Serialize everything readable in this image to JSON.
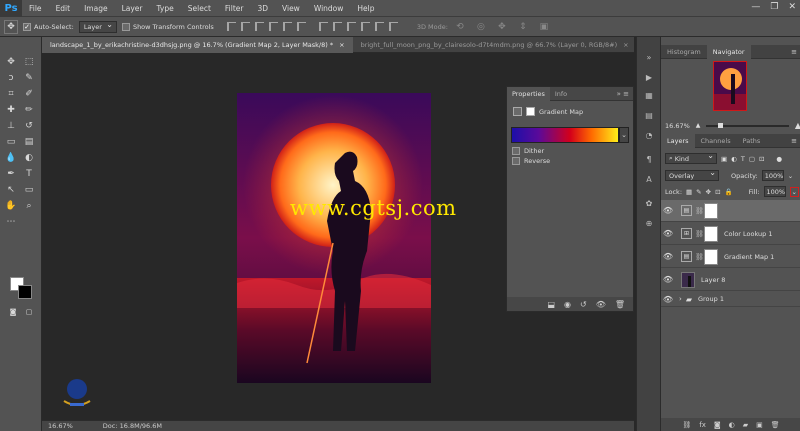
{
  "app": {
    "logo": "Ps"
  },
  "menu": [
    "File",
    "Edit",
    "Image",
    "Layer",
    "Type",
    "Select",
    "Filter",
    "3D",
    "View",
    "Window",
    "Help"
  ],
  "window_controls": [
    "—",
    "❐",
    "✕"
  ],
  "options_bar": {
    "auto_select_label": "Auto-Select:",
    "auto_select_value": "Layer",
    "show_transform_label": "Show Transform Controls",
    "mode_3d_label": "3D Mode:"
  },
  "tabs": [
    {
      "label": "landscape_1_by_erikachristine-d3dhsjg.png @ 16.7% (Gradient Map 2, Layer Mask/8) *",
      "close": "×"
    },
    {
      "label": "bright_full_moon_png_by_clairesolo-d7t4mdm.png @ 66.7% (Layer 0, RGB/8#)",
      "close": "×"
    }
  ],
  "watermark": "www.cgtsj.com",
  "status": {
    "zoom": "16.67%",
    "doc": "Doc: 16.8M/96.6M"
  },
  "properties": {
    "tabs": [
      "Properties",
      "Info"
    ],
    "title": "Gradient Map",
    "dither_label": "Dither",
    "reverse_label": "Reverse",
    "gradient_colors": [
      "#1c0fa8",
      "#5a0a9a",
      "#d4001a",
      "#ff6a00",
      "#ffef1a"
    ]
  },
  "navigator": {
    "tabs": [
      "Histogram",
      "Navigator"
    ],
    "zoom": "16.67%"
  },
  "layers": {
    "tabs": [
      "Layers",
      "Channels",
      "Paths"
    ],
    "filter_kind": "Kind",
    "blend_mode": "Overlay",
    "opacity_label": "Opacity:",
    "opacity_value": "100%",
    "lock_label": "Lock:",
    "fill_label": "Fill:",
    "fill_value": "100%",
    "items": [
      {
        "name": "",
        "type": "adjustment"
      },
      {
        "name": "Color Lookup 1",
        "type": "adjustment"
      },
      {
        "name": "Gradient Map 1",
        "type": "adjustment"
      },
      {
        "name": "Layer 8",
        "type": "pixel"
      },
      {
        "name": "Group 1",
        "type": "group"
      }
    ]
  }
}
